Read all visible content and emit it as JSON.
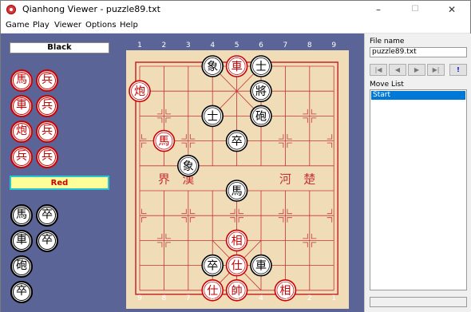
{
  "window": {
    "title": "Qianhong Viewer - puzzle89.txt",
    "minimize_glyph": "–",
    "maximize_glyph": "☐",
    "close_glyph": "✕"
  },
  "menu": [
    "Game",
    "Play",
    "Viewer",
    "Options",
    "Help"
  ],
  "players": {
    "black": "Black",
    "red": "Red"
  },
  "captured": {
    "red": [
      "馬",
      "兵",
      "車",
      "兵",
      "炮",
      "兵",
      "兵",
      "兵"
    ],
    "black": [
      "馬",
      "卒",
      "車",
      "卒",
      "砲",
      "卒"
    ]
  },
  "board": {
    "top_coords": [
      "1",
      "2",
      "3",
      "4",
      "5",
      "6",
      "7",
      "8",
      "9"
    ],
    "bottom_coords": [
      "9",
      "8",
      "7",
      "6",
      "5",
      "4",
      "3",
      "2",
      "1"
    ],
    "river_left": [
      "界",
      "漢"
    ],
    "river_right": [
      "河",
      "楚"
    ],
    "pieces": [
      {
        "col": 3,
        "row": 0,
        "char": "象",
        "color": "black"
      },
      {
        "col": 4,
        "row": 0,
        "char": "車",
        "color": "red"
      },
      {
        "col": 5,
        "row": 0,
        "char": "士",
        "color": "black"
      },
      {
        "col": 0,
        "row": 1,
        "char": "炮",
        "color": "red"
      },
      {
        "col": 5,
        "row": 1,
        "char": "將",
        "color": "black"
      },
      {
        "col": 3,
        "row": 2,
        "char": "士",
        "color": "black"
      },
      {
        "col": 5,
        "row": 2,
        "char": "砲",
        "color": "black"
      },
      {
        "col": 1,
        "row": 3,
        "char": "馬",
        "color": "red"
      },
      {
        "col": 4,
        "row": 3,
        "char": "卒",
        "color": "black"
      },
      {
        "col": 2,
        "row": 4,
        "char": "象",
        "color": "black"
      },
      {
        "col": 4,
        "row": 5,
        "char": "馬",
        "color": "black"
      },
      {
        "col": 4,
        "row": 7,
        "char": "相",
        "color": "red"
      },
      {
        "col": 3,
        "row": 8,
        "char": "卒",
        "color": "black"
      },
      {
        "col": 4,
        "row": 8,
        "char": "仕",
        "color": "red"
      },
      {
        "col": 5,
        "row": 8,
        "char": "車",
        "color": "black"
      },
      {
        "col": 3,
        "row": 9,
        "char": "仕",
        "color": "red"
      },
      {
        "col": 4,
        "row": 9,
        "char": "帥",
        "color": "red"
      },
      {
        "col": 6,
        "row": 9,
        "char": "相",
        "color": "red"
      }
    ]
  },
  "side_panel": {
    "file_name_label": "File name",
    "file_name_value": "puzzle89.txt",
    "nav_buttons": [
      "|◀",
      "◀",
      "▶",
      "▶|",
      "!"
    ],
    "move_list_label": "Move List",
    "moves": [
      "Start"
    ]
  },
  "colors": {
    "red": "#cc0000",
    "black": "#000000",
    "board": "#f0ddb8",
    "panel": "#5a6496",
    "select": "#0078d7"
  }
}
